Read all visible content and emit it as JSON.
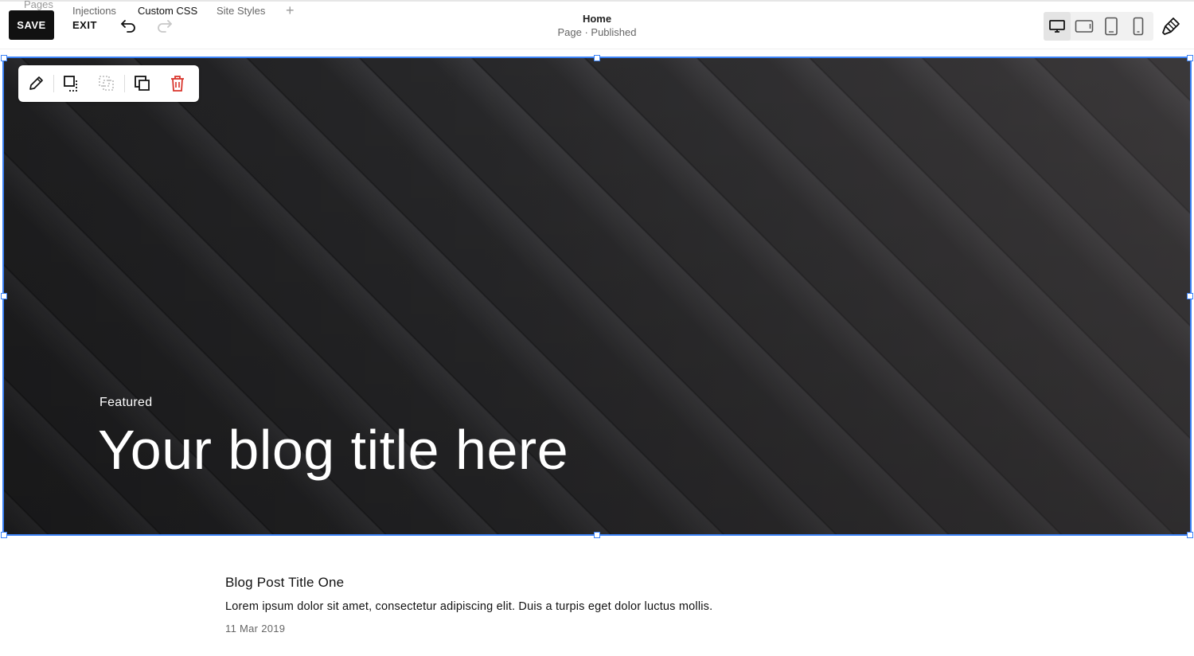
{
  "header": {
    "tabs": [
      {
        "label": "Pages"
      },
      {
        "label": "Injections"
      },
      {
        "label": "Custom CSS"
      },
      {
        "label": "Site Styles"
      },
      {
        "label": "+"
      }
    ],
    "save_label": "SAVE",
    "exit_label": "EXIT",
    "page_title": "Home",
    "page_status": "Page · Published",
    "icons": {
      "undo": "undo-icon",
      "redo": "redo-icon",
      "desktop": "desktop-icon",
      "tablet_landscape": "tablet-landscape-icon",
      "tablet_portrait": "tablet-portrait-icon",
      "mobile": "mobile-icon",
      "site_styles": "paintbrush-icon"
    }
  },
  "block_toolbar": {
    "icons": [
      "pencil-icon",
      "move-icon",
      "select-icon",
      "duplicate-icon",
      "trash-icon"
    ]
  },
  "hero": {
    "eyebrow": "Featured",
    "title": "Your blog title here"
  },
  "posts": [
    {
      "title": "Blog Post Title One",
      "excerpt": "Lorem ipsum dolor sit amet, consectetur adipiscing elit. Duis a turpis eget dolor luctus mollis.",
      "date": "11 Mar 2019"
    }
  ],
  "colors": {
    "selection": "#3b82f6",
    "delete": "#d9342b",
    "save_bg": "#111111"
  }
}
